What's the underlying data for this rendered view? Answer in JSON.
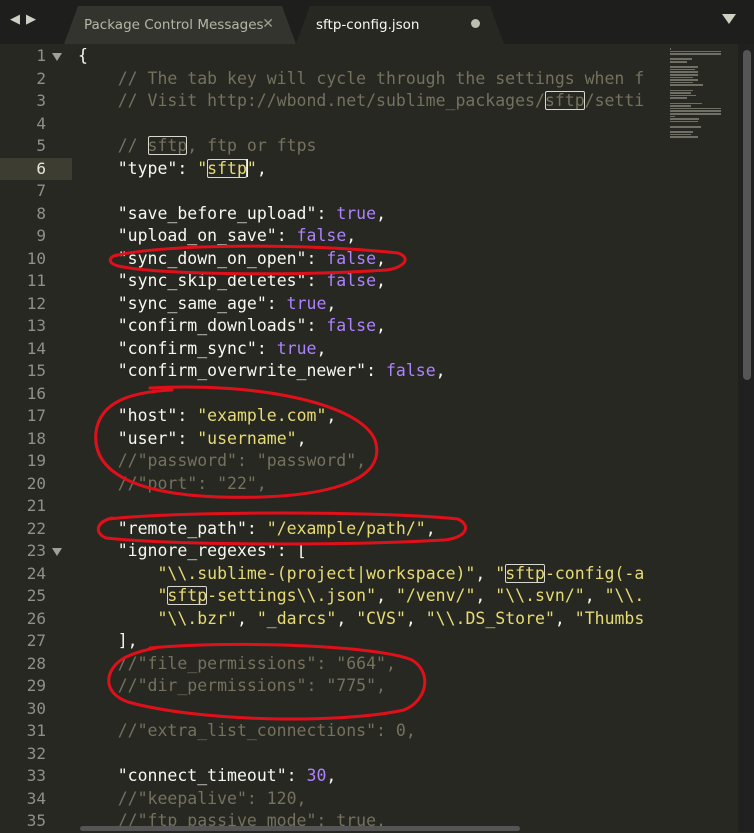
{
  "tabs": [
    {
      "label": "Package Control Messages",
      "active": false
    },
    {
      "label": "sftp-config.json",
      "active": true
    }
  ],
  "code_lines": [
    {
      "n": "1",
      "segs": [
        {
          "t": "{"
        }
      ],
      "fold": true
    },
    {
      "n": "2",
      "segs": [
        {
          "t": "    // The tab key will cycle through the settings when f",
          "c": "com"
        }
      ]
    },
    {
      "n": "3",
      "segs": [
        {
          "t": "    // Visit http://wbond.net/sublime_packages/",
          "c": "com"
        },
        {
          "t": "sftp",
          "c": "com",
          "m": true
        },
        {
          "t": "/setti",
          "c": "com"
        }
      ]
    },
    {
      "n": "4",
      "segs": []
    },
    {
      "n": "5",
      "segs": [
        {
          "t": "    // ",
          "c": "com"
        },
        {
          "t": "sftp",
          "c": "com",
          "m": true
        },
        {
          "t": ", ftp or ftps",
          "c": "com"
        }
      ]
    },
    {
      "n": "6",
      "segs": [
        {
          "t": "    "
        },
        {
          "t": "\"type\"",
          "c": "key"
        },
        {
          "t": ": "
        },
        {
          "t": "\"",
          "c": "str"
        },
        {
          "t": "sftp",
          "c": "str",
          "m": true
        },
        {
          "t": "",
          "caret": true
        },
        {
          "t": "\"",
          "c": "str"
        },
        {
          "t": ","
        }
      ],
      "current": true
    },
    {
      "n": "7",
      "segs": []
    },
    {
      "n": "8",
      "segs": [
        {
          "t": "    "
        },
        {
          "t": "\"save_before_upload\"",
          "c": "key"
        },
        {
          "t": ": "
        },
        {
          "t": "true",
          "c": "bool"
        },
        {
          "t": ","
        }
      ]
    },
    {
      "n": "9",
      "segs": [
        {
          "t": "    "
        },
        {
          "t": "\"upload_on_save\"",
          "c": "key"
        },
        {
          "t": ": "
        },
        {
          "t": "false",
          "c": "bool"
        },
        {
          "t": ","
        }
      ]
    },
    {
      "n": "10",
      "segs": [
        {
          "t": "    "
        },
        {
          "t": "\"sync_down_on_open\"",
          "c": "key"
        },
        {
          "t": ": "
        },
        {
          "t": "false",
          "c": "bool"
        },
        {
          "t": ","
        }
      ]
    },
    {
      "n": "11",
      "segs": [
        {
          "t": "    "
        },
        {
          "t": "\"sync_skip_deletes\"",
          "c": "key"
        },
        {
          "t": ": "
        },
        {
          "t": "false",
          "c": "bool"
        },
        {
          "t": ","
        }
      ]
    },
    {
      "n": "12",
      "segs": [
        {
          "t": "    "
        },
        {
          "t": "\"sync_same_age\"",
          "c": "key"
        },
        {
          "t": ": "
        },
        {
          "t": "true",
          "c": "bool"
        },
        {
          "t": ","
        }
      ]
    },
    {
      "n": "13",
      "segs": [
        {
          "t": "    "
        },
        {
          "t": "\"confirm_downloads\"",
          "c": "key"
        },
        {
          "t": ": "
        },
        {
          "t": "false",
          "c": "bool"
        },
        {
          "t": ","
        }
      ]
    },
    {
      "n": "14",
      "segs": [
        {
          "t": "    "
        },
        {
          "t": "\"confirm_sync\"",
          "c": "key"
        },
        {
          "t": ": "
        },
        {
          "t": "true",
          "c": "bool"
        },
        {
          "t": ","
        }
      ]
    },
    {
      "n": "15",
      "segs": [
        {
          "t": "    "
        },
        {
          "t": "\"confirm_overwrite_newer\"",
          "c": "key"
        },
        {
          "t": ": "
        },
        {
          "t": "false",
          "c": "bool"
        },
        {
          "t": ","
        }
      ]
    },
    {
      "n": "16",
      "segs": []
    },
    {
      "n": "17",
      "segs": [
        {
          "t": "    "
        },
        {
          "t": "\"host\"",
          "c": "key"
        },
        {
          "t": ": "
        },
        {
          "t": "\"example.com\"",
          "c": "str"
        },
        {
          "t": ","
        }
      ]
    },
    {
      "n": "18",
      "segs": [
        {
          "t": "    "
        },
        {
          "t": "\"user\"",
          "c": "key"
        },
        {
          "t": ": "
        },
        {
          "t": "\"username\"",
          "c": "str"
        },
        {
          "t": ","
        }
      ]
    },
    {
      "n": "19",
      "segs": [
        {
          "t": "    //\"password\": \"password\",",
          "c": "com"
        }
      ]
    },
    {
      "n": "20",
      "segs": [
        {
          "t": "    //\"port\": \"22\",",
          "c": "com"
        }
      ]
    },
    {
      "n": "21",
      "segs": []
    },
    {
      "n": "22",
      "segs": [
        {
          "t": "    "
        },
        {
          "t": "\"remote_path\"",
          "c": "key"
        },
        {
          "t": ": "
        },
        {
          "t": "\"/example/path/\"",
          "c": "str"
        },
        {
          "t": ","
        }
      ]
    },
    {
      "n": "23",
      "segs": [
        {
          "t": "    "
        },
        {
          "t": "\"ignore_regexes\"",
          "c": "key"
        },
        {
          "t": ": ["
        }
      ],
      "fold": true
    },
    {
      "n": "24",
      "segs": [
        {
          "t": "        "
        },
        {
          "t": "\"\\\\.sublime-(project|workspace)\"",
          "c": "str"
        },
        {
          "t": ", "
        },
        {
          "t": "\"",
          "c": "str"
        },
        {
          "t": "sftp",
          "c": "str",
          "m": true
        },
        {
          "t": "-config(-a",
          "c": "str"
        }
      ]
    },
    {
      "n": "25",
      "segs": [
        {
          "t": "        "
        },
        {
          "t": "\"",
          "c": "str"
        },
        {
          "t": "sftp",
          "c": "str",
          "m": true
        },
        {
          "t": "-settings\\\\.json\"",
          "c": "str"
        },
        {
          "t": ", "
        },
        {
          "t": "\"/venv/\"",
          "c": "str"
        },
        {
          "t": ", "
        },
        {
          "t": "\"\\\\.svn/\"",
          "c": "str"
        },
        {
          "t": ", "
        },
        {
          "t": "\"\\\\.",
          "c": "str"
        }
      ]
    },
    {
      "n": "26",
      "segs": [
        {
          "t": "        "
        },
        {
          "t": "\"\\\\.bzr\"",
          "c": "str"
        },
        {
          "t": ", "
        },
        {
          "t": "\"_darcs\"",
          "c": "str"
        },
        {
          "t": ", "
        },
        {
          "t": "\"CVS\"",
          "c": "str"
        },
        {
          "t": ", "
        },
        {
          "t": "\"\\\\.DS_Store\"",
          "c": "str"
        },
        {
          "t": ", "
        },
        {
          "t": "\"Thumbs",
          "c": "str"
        }
      ]
    },
    {
      "n": "27",
      "segs": [
        {
          "t": "    ],"
        }
      ]
    },
    {
      "n": "28",
      "segs": [
        {
          "t": "    //\"file_permissions\": \"664\",",
          "c": "com"
        }
      ]
    },
    {
      "n": "29",
      "segs": [
        {
          "t": "    //\"dir_permissions\": \"775\",",
          "c": "com"
        }
      ]
    },
    {
      "n": "30",
      "segs": []
    },
    {
      "n": "31",
      "segs": [
        {
          "t": "    //\"extra_list_connections\": 0,",
          "c": "com"
        }
      ]
    },
    {
      "n": "32",
      "segs": []
    },
    {
      "n": "33",
      "segs": [
        {
          "t": "    "
        },
        {
          "t": "\"connect_timeout\"",
          "c": "key"
        },
        {
          "t": ": "
        },
        {
          "t": "30",
          "c": "num"
        },
        {
          "t": ","
        }
      ]
    },
    {
      "n": "34",
      "segs": [
        {
          "t": "    //\"keepalive\": 120,",
          "c": "com"
        }
      ]
    },
    {
      "n": "35",
      "segs": [
        {
          "t": "    //\"ftp_passive_mode\": true,",
          "c": "com"
        }
      ]
    }
  ],
  "colors": {
    "background": "#272822",
    "comment": "#75715e",
    "string": "#e6db74",
    "constant": "#ae81ff",
    "text": "#f8f8f2",
    "annotation": "#e0101a"
  }
}
